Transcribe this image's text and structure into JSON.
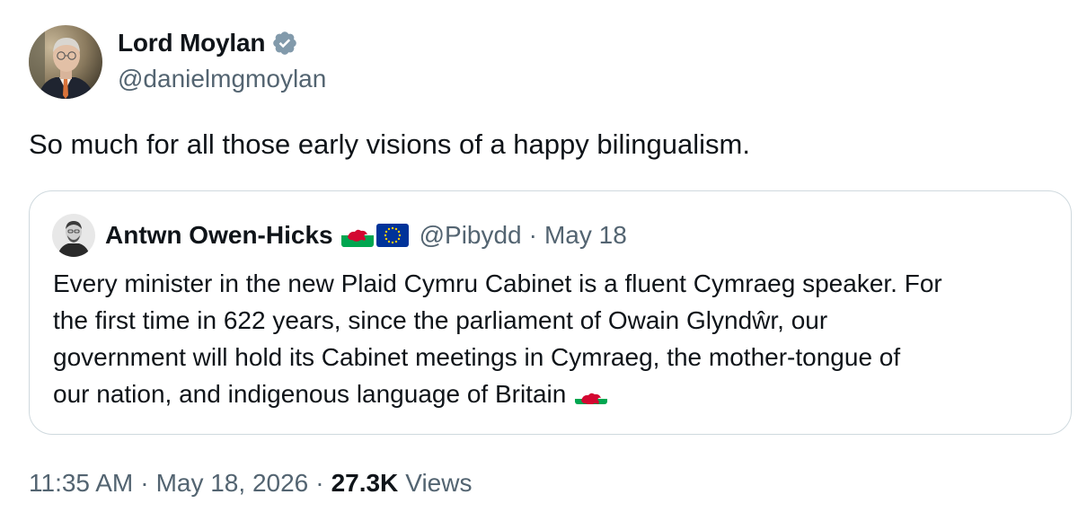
{
  "author": {
    "name": "Lord Moylan",
    "handle": "@danielmgmoylan",
    "verified": true
  },
  "tweet": {
    "text": "So much for all those early visions of a happy bilingualism."
  },
  "quoted_tweet": {
    "name": "Antwn Owen-Hicks",
    "flags": [
      "wales-flag-icon",
      "eu-flag-icon"
    ],
    "handle": "@Pibydd",
    "separator": "·",
    "date": "May 18",
    "text_lines": [
      "Every minister in the new Plaid Cymru Cabinet is a fluent Cymraeg speaker. For",
      "the first time in 622 years, since the parliament of Owain Glyndŵr, our",
      "government will hold its Cabinet meetings in Cymraeg, the mother-tongue of",
      "our nation, and indigenous language of Britain"
    ],
    "trailing_emoji": "wales-flag-icon"
  },
  "meta": {
    "time": "11:35 AM",
    "separator": "·",
    "date": "May 18, 2026",
    "views_count": "27.3K",
    "views_label": "Views"
  },
  "colors": {
    "primary_text": "#0f1419",
    "secondary_text": "#536471",
    "border": "#cfd9de",
    "verified_badge": "#829aab",
    "wales_green": "#00a650",
    "wales_red": "#d30731",
    "eu_blue": "#003399",
    "eu_star": "#ffcc00"
  }
}
